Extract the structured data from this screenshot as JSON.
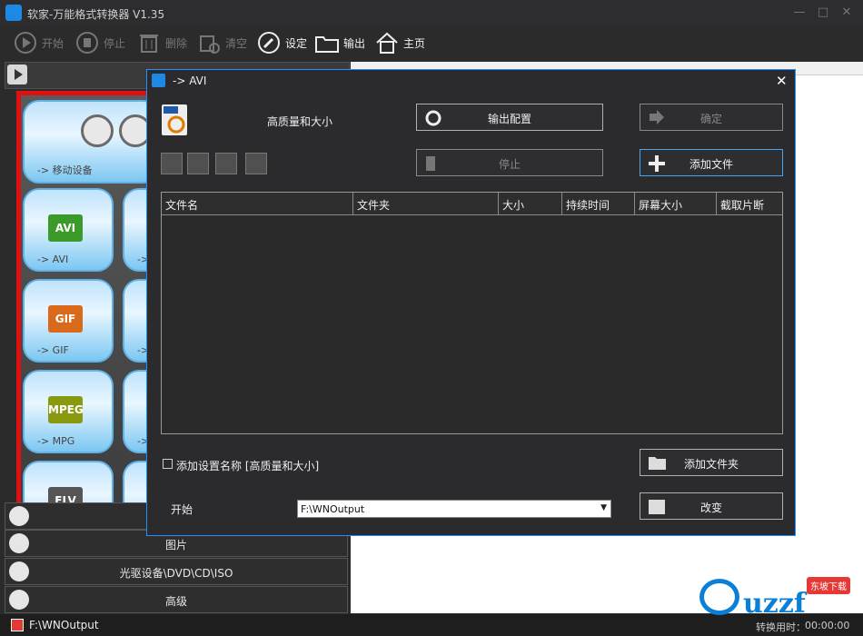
{
  "app": {
    "title": "软家-万能格式转换器 V1.35"
  },
  "toolbar": {
    "start": "开始",
    "stop": "停止",
    "delete": "删除",
    "clear": "清空",
    "settings": "设定",
    "output": "输出",
    "home": "主页"
  },
  "left": {
    "tiles": [
      {
        "label": "-> 移动设备"
      },
      {
        "label": "-> AVI",
        "badge": "AVI",
        "color": "#3a9a2a"
      },
      {
        "label": "-> GIF",
        "badge": "GIF",
        "color": "#d96a1a"
      },
      {
        "label": "-> MPG",
        "badge": "MPEG",
        "color": "#8a9a10"
      },
      {
        "label": "",
        "badge": "FLV",
        "color": "#555555"
      },
      {
        "label": "->"
      },
      {
        "label": "->"
      },
      {
        "label": "->"
      }
    ],
    "categories": [
      {
        "label": "",
        "icon": "music-icon"
      },
      {
        "label": "图片",
        "icon": "picture-icon"
      },
      {
        "label": "光驱设备\\DVD\\CD\\ISO",
        "icon": "disc-icon"
      },
      {
        "label": "高级",
        "icon": "swap-icon"
      }
    ]
  },
  "dialog": {
    "title": "-> AVI",
    "profile": "高质量和大小",
    "buttons": {
      "output_config": "输出配置",
      "confirm": "确定",
      "stop": "停止",
      "add_file": "添加文件",
      "add_folder": "添加文件夹",
      "change": "改变"
    },
    "columns": [
      "文件名",
      "文件夹",
      "大小",
      "持续时间",
      "屏幕大小",
      "截取片断"
    ],
    "checkbox_label": "添加设置名称 [高质量和大小]",
    "start_label": "开始",
    "output_path": "F:\\WNOutput"
  },
  "status": {
    "path": "F:\\WNOutput",
    "time_label": "转换用时：",
    "time": "00:00:00"
  },
  "watermark": {
    "text": "uzzf",
    "tag": "东坡下载"
  }
}
